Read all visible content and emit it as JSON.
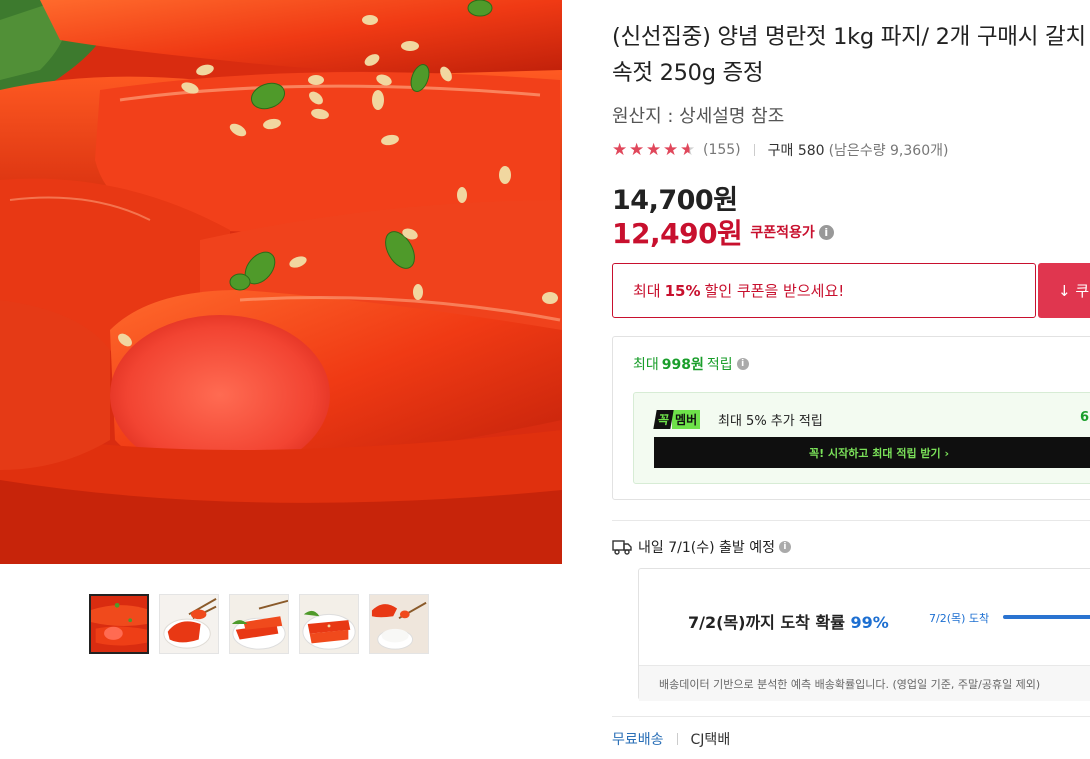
{
  "product": {
    "title": "(신선집중) 양념 명란젓 1kg 파지/ 2개 구매시 갈치속젓 250g 증정",
    "origin": "원산지 : 상세설명 참조",
    "rating": 4.5,
    "review_count": "(155)",
    "purchase_count": "구매 580",
    "stock": "(남은수량 9,360개)"
  },
  "price": {
    "original": "14,700원",
    "sale": "12,490원",
    "sale_label": "쿠폰적용가",
    "info_icon": "info-icon"
  },
  "coupon": {
    "prefix": "최대",
    "percent": "15%",
    "suffix": "할인 쿠폰을 받으세요!",
    "button_label": "↓ 쿠"
  },
  "reward": {
    "prefix": "최대",
    "amount": "998원",
    "suffix": "적립",
    "member_badge_left": "꼭",
    "member_badge_right": "멤버",
    "member_text": "최대 5% 추가 적립",
    "member_points": "6",
    "cta": "꼭! 시작하고 최대 적립 받기 ›"
  },
  "shipping": {
    "departure": "내일 7/1(수) 출발 예정",
    "prob_text": "7/2(목)까지 도착 확률",
    "prob_percent": "99%",
    "arrive_label": "7/2(목) 도착",
    "note": "배송데이터 기반으로 분석한 예측 배송확률입니다. (영업일 기준, 주말/공휴일 제외)",
    "free": "무료배송",
    "courier": "CJ택배"
  },
  "colors": {
    "accent_red": "#c8102e",
    "reward_green": "#1a9e2b",
    "link_blue": "#2a6fb7"
  }
}
